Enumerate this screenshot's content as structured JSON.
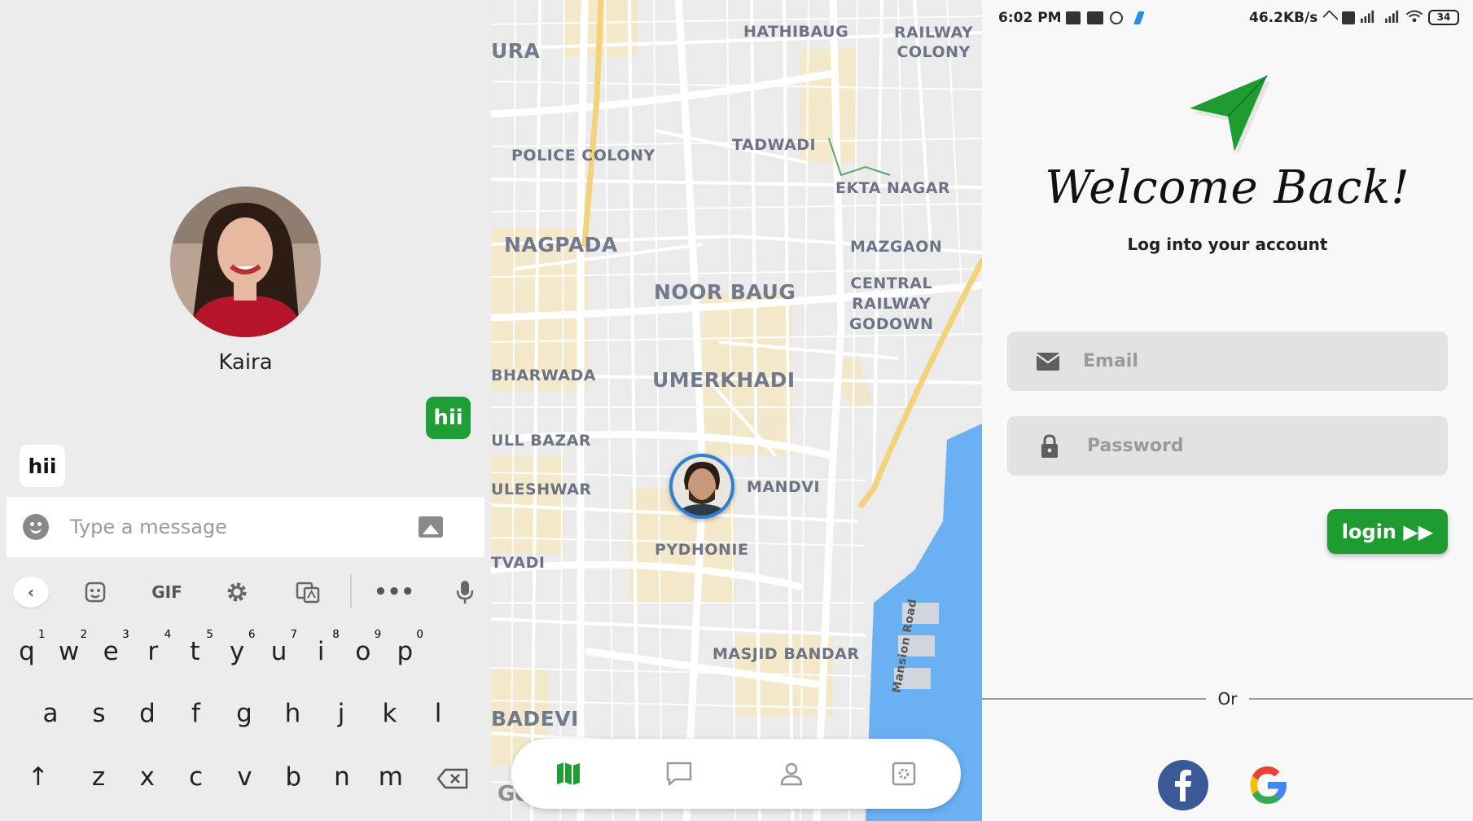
{
  "chat": {
    "contact_name": "Kaira",
    "sent_message": "hii",
    "received_message": "hii",
    "composer_placeholder": "Type a message",
    "keyboard": {
      "gif_label": "GIF",
      "row1": [
        [
          "q",
          "1"
        ],
        [
          "w",
          "2"
        ],
        [
          "e",
          "3"
        ],
        [
          "r",
          "4"
        ],
        [
          "t",
          "5"
        ],
        [
          "y",
          "6"
        ],
        [
          "u",
          "7"
        ],
        [
          "i",
          "8"
        ],
        [
          "o",
          "9"
        ],
        [
          "p",
          "0"
        ]
      ],
      "row2": [
        "a",
        "s",
        "d",
        "f",
        "g",
        "h",
        "j",
        "k",
        "l"
      ],
      "row3": [
        "z",
        "x",
        "c",
        "v",
        "b",
        "n",
        "m"
      ]
    }
  },
  "map": {
    "labels": {
      "ura": "URA",
      "hathibaug": "HATHIBAUG",
      "railway_colony_1": "RAILWAY",
      "railway_colony_2": "COLONY",
      "police_colony": "POLICE COLONY",
      "tadwadi": "TADWADI",
      "ekta_nagar": "EKTA NAGAR",
      "nagpada": "NAGPADA",
      "mazgaon": "MAZGAON",
      "noor_baug": "NOOR BAUG",
      "central_1": "CENTRAL",
      "central_2": "RAILWAY",
      "central_3": "GODOWN",
      "bharwada": "BHARWADA",
      "umerkhadi": "UMERKHADI",
      "ull_bazar": "ULL BAZAR",
      "mandvi": "MANDVI",
      "uleshwar": "ULESHWAR",
      "pydhonie": "PYDHONIE",
      "tvadi": "TVADI",
      "mansion_road": "Mansion Road",
      "masjid_bandar": "MASJID BANDAR",
      "badevi": "BADEVI"
    },
    "google_mark": "Goo",
    "nav": [
      "map-icon",
      "chat-icon",
      "profile-icon",
      "settings-icon"
    ]
  },
  "login": {
    "status": {
      "time": "6:02 PM",
      "speed": "46.2KB/s",
      "battery": "34"
    },
    "title": "Welcome Back!",
    "subtitle": "Log into your account",
    "email_placeholder": "Email",
    "password_placeholder": "Password",
    "login_label": "login ▶▶",
    "or_label": "Or",
    "colors": {
      "accent": "#1f9c30",
      "facebook": "#3b5998"
    }
  }
}
